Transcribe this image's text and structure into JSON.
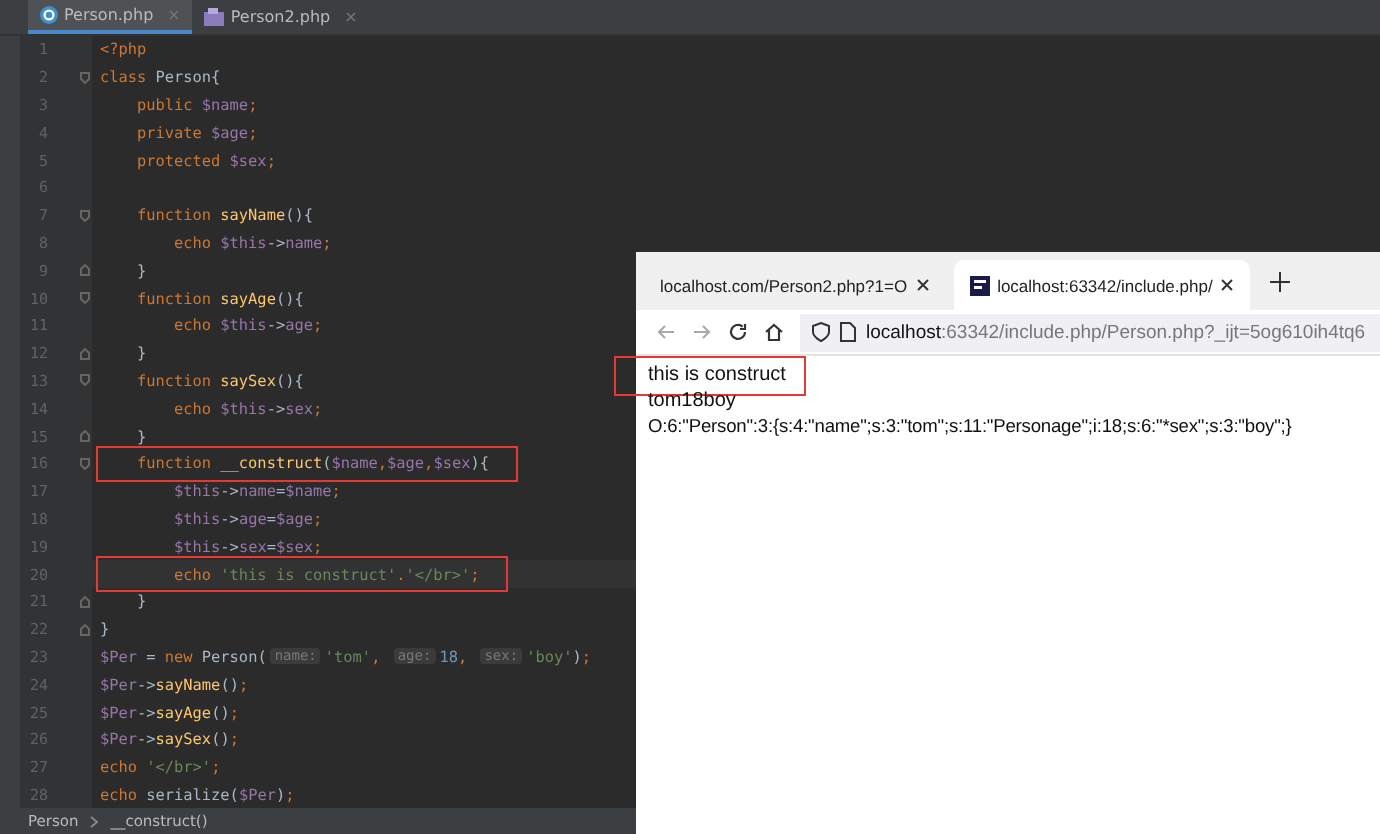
{
  "editor": {
    "tabs": [
      {
        "label": "Person.php",
        "close": "×",
        "selected": true,
        "kind": "class"
      },
      {
        "label": "Person2.php",
        "close": "×",
        "selected": false,
        "kind": "script"
      }
    ],
    "lines": [
      {
        "number": "1",
        "kind": "code",
        "tokens": [
          {
            "kind": "keyword",
            "text": "<?php"
          }
        ]
      },
      {
        "number": "2",
        "kind": "fold-start",
        "tokens": [
          {
            "kind": "keyword",
            "text": "class "
          },
          {
            "kind": "plain",
            "text": "Person{"
          }
        ]
      },
      {
        "number": "3",
        "kind": "code",
        "tokens": [
          {
            "kind": "keyword",
            "text": "    public "
          },
          {
            "kind": "var",
            "text": "$name"
          },
          {
            "kind": "keyword",
            "text": ";"
          }
        ]
      },
      {
        "number": "4",
        "kind": "code",
        "tokens": [
          {
            "kind": "keyword",
            "text": "    private "
          },
          {
            "kind": "var",
            "text": "$age"
          },
          {
            "kind": "keyword",
            "text": ";"
          }
        ]
      },
      {
        "number": "5",
        "kind": "code",
        "tokens": [
          {
            "kind": "keyword",
            "text": "    protected "
          },
          {
            "kind": "var",
            "text": "$sex"
          },
          {
            "kind": "keyword",
            "text": ";"
          }
        ]
      },
      {
        "number": "6",
        "kind": "code"
      },
      {
        "number": "7",
        "kind": "fold-start",
        "tokens": [
          {
            "kind": "keyword",
            "text": "    function "
          },
          {
            "kind": "func",
            "text": "sayName"
          },
          {
            "kind": "plain",
            "text": "(){"
          }
        ]
      },
      {
        "number": "8",
        "kind": "code",
        "tokens": [
          {
            "kind": "keyword",
            "text": "        echo "
          },
          {
            "kind": "var",
            "text": "$this"
          },
          {
            "kind": "plain",
            "text": "->"
          },
          {
            "kind": "var",
            "text": "name"
          },
          {
            "kind": "keyword",
            "text": ";"
          }
        ]
      },
      {
        "number": "9",
        "kind": "fold-end",
        "tokens": [
          {
            "kind": "plain",
            "text": "    }"
          }
        ]
      },
      {
        "number": "10",
        "kind": "fold-start",
        "tokens": [
          {
            "kind": "keyword",
            "text": "    function "
          },
          {
            "kind": "func",
            "text": "sayAge"
          },
          {
            "kind": "plain",
            "text": "(){"
          }
        ]
      },
      {
        "number": "11",
        "kind": "code",
        "tokens": [
          {
            "kind": "keyword",
            "text": "        echo "
          },
          {
            "kind": "var",
            "text": "$this"
          },
          {
            "kind": "plain",
            "text": "->"
          },
          {
            "kind": "var",
            "text": "age"
          },
          {
            "kind": "keyword",
            "text": ";"
          }
        ]
      },
      {
        "number": "12",
        "kind": "fold-end",
        "tokens": [
          {
            "kind": "plain",
            "text": "    }"
          }
        ]
      },
      {
        "number": "13",
        "kind": "fold-start",
        "tokens": [
          {
            "kind": "keyword",
            "text": "    function "
          },
          {
            "kind": "func",
            "text": "saySex"
          },
          {
            "kind": "plain",
            "text": "(){"
          }
        ]
      },
      {
        "number": "14",
        "kind": "code",
        "tokens": [
          {
            "kind": "keyword",
            "text": "        echo "
          },
          {
            "kind": "var",
            "text": "$this"
          },
          {
            "kind": "plain",
            "text": "->"
          },
          {
            "kind": "var",
            "text": "sex"
          },
          {
            "kind": "keyword",
            "text": ";"
          }
        ]
      },
      {
        "number": "15",
        "kind": "fold-end",
        "tokens": [
          {
            "kind": "plain",
            "text": "    }"
          }
        ]
      },
      {
        "number": "16",
        "kind": "fold-start",
        "boxed": true,
        "tokens": [
          {
            "kind": "keyword",
            "text": "    function "
          },
          {
            "kind": "func",
            "text": "__construct"
          },
          {
            "kind": "plain",
            "text": "("
          },
          {
            "kind": "var",
            "text": "$name"
          },
          {
            "kind": "keyword",
            "text": ","
          },
          {
            "kind": "var",
            "text": "$age"
          },
          {
            "kind": "keyword",
            "text": ","
          },
          {
            "kind": "var",
            "text": "$sex"
          },
          {
            "kind": "plain",
            "text": "){"
          }
        ]
      },
      {
        "number": "17",
        "kind": "code",
        "tokens": [
          {
            "kind": "var",
            "text": "        $this"
          },
          {
            "kind": "plain",
            "text": "->"
          },
          {
            "kind": "var",
            "text": "name"
          },
          {
            "kind": "plain",
            "text": "="
          },
          {
            "kind": "var",
            "text": "$name"
          },
          {
            "kind": "keyword",
            "text": ";"
          }
        ]
      },
      {
        "number": "18",
        "kind": "code",
        "tokens": [
          {
            "kind": "var",
            "text": "        $this"
          },
          {
            "kind": "plain",
            "text": "->"
          },
          {
            "kind": "var",
            "text": "age"
          },
          {
            "kind": "plain",
            "text": "="
          },
          {
            "kind": "var",
            "text": "$age"
          },
          {
            "kind": "keyword",
            "text": ";"
          }
        ]
      },
      {
        "number": "19",
        "kind": "code",
        "tokens": [
          {
            "kind": "var",
            "text": "        $this"
          },
          {
            "kind": "plain",
            "text": "->"
          },
          {
            "kind": "var",
            "text": "sex"
          },
          {
            "kind": "plain",
            "text": "="
          },
          {
            "kind": "var",
            "text": "$sex"
          },
          {
            "kind": "keyword",
            "text": ";"
          }
        ]
      },
      {
        "number": "20",
        "kind": "code",
        "current": true,
        "boxed": true,
        "tokens": [
          {
            "kind": "keyword",
            "text": "        echo "
          },
          {
            "kind": "string",
            "text": "'this is construct'"
          },
          {
            "kind": "keyword",
            "text": "."
          },
          {
            "kind": "string",
            "text": "'</br>'"
          },
          {
            "kind": "keyword",
            "text": ";"
          }
        ]
      },
      {
        "number": "21",
        "kind": "fold-end",
        "tokens": [
          {
            "kind": "plain",
            "text": "    }"
          }
        ]
      },
      {
        "number": "22",
        "kind": "fold-end",
        "tokens": [
          {
            "kind": "plain",
            "text": "}"
          }
        ]
      },
      {
        "number": "23",
        "kind": "code",
        "tokens": [
          {
            "kind": "var",
            "text": "$Per"
          },
          {
            "kind": "plain",
            "text": " = "
          },
          {
            "kind": "keyword",
            "text": "new "
          },
          {
            "kind": "plain",
            "text": "Person("
          },
          {
            "kind": "hint",
            "text": "name:"
          },
          {
            "kind": "string",
            "text": "'tom'"
          },
          {
            "kind": "keyword",
            "text": ", "
          },
          {
            "kind": "hint",
            "text": "age:"
          },
          {
            "kind": "number",
            "text": "18"
          },
          {
            "kind": "keyword",
            "text": ", "
          },
          {
            "kind": "hint",
            "text": "sex:"
          },
          {
            "kind": "string",
            "text": "'boy'"
          },
          {
            "kind": "plain",
            "text": ")"
          },
          {
            "kind": "keyword",
            "text": ";"
          }
        ]
      },
      {
        "number": "24",
        "kind": "code",
        "tokens": [
          {
            "kind": "var",
            "text": "$Per"
          },
          {
            "kind": "plain",
            "text": "->"
          },
          {
            "kind": "func",
            "text": "sayName"
          },
          {
            "kind": "plain",
            "text": "()"
          },
          {
            "kind": "keyword",
            "text": ";"
          }
        ]
      },
      {
        "number": "25",
        "kind": "code",
        "tokens": [
          {
            "kind": "var",
            "text": "$Per"
          },
          {
            "kind": "plain",
            "text": "->"
          },
          {
            "kind": "func",
            "text": "sayAge"
          },
          {
            "kind": "plain",
            "text": "()"
          },
          {
            "kind": "keyword",
            "text": ";"
          }
        ]
      },
      {
        "number": "26",
        "kind": "code",
        "tokens": [
          {
            "kind": "var",
            "text": "$Per"
          },
          {
            "kind": "plain",
            "text": "->"
          },
          {
            "kind": "func",
            "text": "saySex"
          },
          {
            "kind": "plain",
            "text": "()"
          },
          {
            "kind": "keyword",
            "text": ";"
          }
        ]
      },
      {
        "number": "27",
        "kind": "code",
        "tokens": [
          {
            "kind": "keyword",
            "text": "echo "
          },
          {
            "kind": "string",
            "text": "'</br>'"
          },
          {
            "kind": "keyword",
            "text": ";"
          }
        ]
      },
      {
        "number": "28",
        "kind": "code",
        "tokens": [
          {
            "kind": "keyword",
            "text": "echo "
          },
          {
            "kind": "plain",
            "text": "serialize("
          },
          {
            "kind": "var",
            "text": "$Per"
          },
          {
            "kind": "plain",
            "text": ")"
          },
          {
            "kind": "keyword",
            "text": ";"
          }
        ]
      }
    ],
    "breadcrumb": [
      "Person",
      "__construct()"
    ]
  },
  "browser": {
    "tabs": [
      {
        "label": "localhost.com/Person2.php?1=O",
        "selected": false
      },
      {
        "label": "localhost:63342/include.php/",
        "selected": true
      }
    ],
    "address": {
      "host": "localhost",
      "path": ":63342/include.php/Person.php?_ijt=5og610ih4tq6"
    },
    "output": [
      {
        "text": "this is construct",
        "boxed": true
      },
      {
        "text": "tom18boy"
      },
      {
        "text": "O:6:\"Person\":3:{s:4:\"name\";s:3:\"tom\";s:11:\"Personage\";i:18;s:6:\"*sex\";s:3:\"boy\";}"
      }
    ]
  }
}
